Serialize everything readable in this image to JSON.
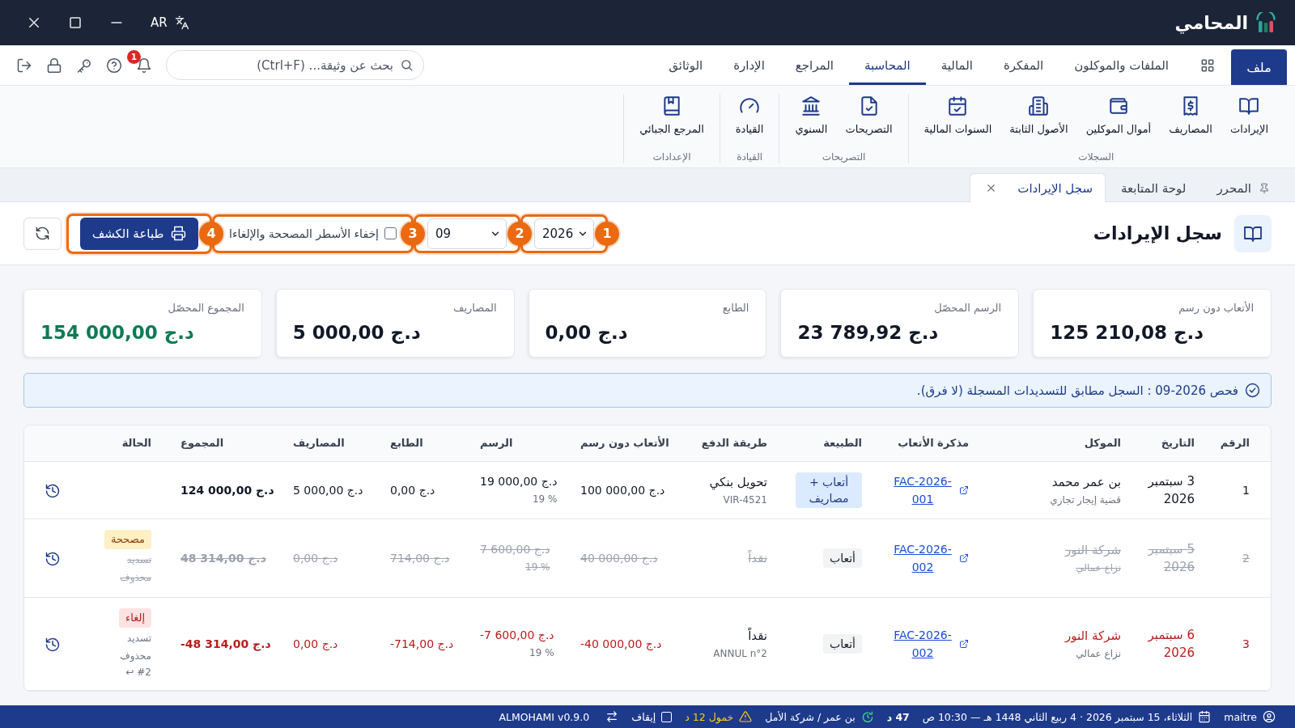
{
  "window": {
    "app_name": "المحامي",
    "language": "AR"
  },
  "menu": {
    "file_button": "ملف",
    "tabs": [
      {
        "label": "الملفات والموكلون",
        "selected": false
      },
      {
        "label": "المفكرة",
        "selected": false
      },
      {
        "label": "المالية",
        "selected": false
      },
      {
        "label": "المحاسبة",
        "selected": true
      },
      {
        "label": "المراجع",
        "selected": false
      },
      {
        "label": "الإدارة",
        "selected": false
      },
      {
        "label": "الوثائق",
        "selected": false
      }
    ],
    "search": {
      "placeholder": "بحث عن وثيقة... (Ctrl+F)"
    },
    "notification_count": "1"
  },
  "ribbon": {
    "groups": [
      {
        "label": "السجلات",
        "items": [
          "الإيرادات",
          "المصاريف",
          "أموال الموكلين",
          "الأصول الثابتة",
          "السنوات المالية"
        ]
      },
      {
        "label": "التصريحات",
        "items": [
          "التصريحات",
          "السنوي"
        ]
      },
      {
        "label": "القيادة",
        "items": [
          "القيادة"
        ]
      },
      {
        "label": "الإعدادات",
        "items": [
          "المرجع الجبائي"
        ]
      }
    ]
  },
  "document_tabs": [
    {
      "label": "المحرر",
      "pinned": true,
      "closable": false,
      "selected": false
    },
    {
      "label": "لوحة المتابعة",
      "pinned": false,
      "closable": false,
      "selected": false
    },
    {
      "label": "سجل الإيرادات",
      "pinned": false,
      "closable": true,
      "selected": true
    }
  ],
  "page": {
    "title": "سجل الإيرادات",
    "year": {
      "value": "2026",
      "marker": "1"
    },
    "month": {
      "value": "09",
      "marker": "2"
    },
    "hide_corrected": {
      "label": "إخفاء الأسطر المصححة والإلغاءا",
      "checked": false,
      "marker": "3"
    },
    "print_button": {
      "label": "طباعة الكشف",
      "marker": "4"
    }
  },
  "summary_cards": [
    {
      "label": "الأتعاب دون رسم",
      "value": "125 210,08 د.ج",
      "highlight": false
    },
    {
      "label": "الرسم المحصّل",
      "value": "23 789,92 د.ج",
      "highlight": false
    },
    {
      "label": "الطابع",
      "value": "0,00 د.ج",
      "highlight": false
    },
    {
      "label": "المصاريف",
      "value": "5 000,00 د.ج",
      "highlight": false
    },
    {
      "label": "المجموع المحصّل",
      "value": "154 000,00 د.ج",
      "highlight": true
    }
  ],
  "check_notice": "فحص 2026-09 : السجل مطابق للتسديدات المسجلة (لا فرق).",
  "table": {
    "columns": [
      "الرقم",
      "التاريخ",
      "الموكل",
      "مذكرة الأتعاب",
      "الطبيعة",
      "طريقة الدفع",
      "الأتعاب دون رسم",
      "الرسم",
      "الطابع",
      "المصاريف",
      "المجموع",
      "الحالة"
    ],
    "rows": [
      {
        "number": "1",
        "date": "3 سبتمبر 2026",
        "client": "بن عمر محمد",
        "case": "قضية إيجار تجاري",
        "invoice": "FAC-2026-001",
        "nature": {
          "label": "أتعاب + مصاريف",
          "kind": "fees_expenses"
        },
        "payment": "تحويل بنكي",
        "payment_ref": "VIR-4521",
        "fees": "100 000,00 د.ج",
        "tax": "19 000,00 د.ج",
        "tax_rate": "19 %",
        "stamp": "0,00 د.ج",
        "expenses": "5 000,00 د.ج",
        "total": "124 000,00 د.ج",
        "kind": "normal"
      },
      {
        "number": "2",
        "date": "5 سبتمبر 2026",
        "client": "شركة النور",
        "case": "نزاع عمالي",
        "invoice": "FAC-2026-002",
        "nature": {
          "label": "أتعاب",
          "kind": "fees"
        },
        "payment": "نقداً",
        "fees": "40 000,00 د.ج",
        "tax": "7 600,00 د.ج",
        "tax_rate": "19 %",
        "stamp": "714,00 د.ج",
        "expenses": "0,00 د.ج",
        "total": "48 314,00 د.ج",
        "kind": "corrected",
        "status": "مصححة",
        "status_note": "تسديد محذوف"
      },
      {
        "number": "3",
        "date": "6 سبتمبر 2026",
        "client": "شركة النور",
        "case": "نزاع عمالي",
        "invoice": "FAC-2026-002",
        "nature": {
          "label": "أتعاب",
          "kind": "fees"
        },
        "payment": "نقداً",
        "payment_ref": "ANNUL n°2",
        "fees": "-40 000,00 د.ج",
        "tax": "-7 600,00 د.ج",
        "tax_rate": "19 %",
        "stamp": "-714,00 د.ج",
        "expenses": "0,00 د.ج",
        "total": "-48 314,00 د.ج",
        "kind": "cancelled",
        "status": "إلغاء",
        "status_note": "تسديد محذوف",
        "reversal_ref": "#2 ↩"
      }
    ]
  },
  "status_bar": {
    "user": "maitre",
    "datetime": "الثلاثاء، 15 سبتمبر 2026 · 4 ربيع الثاني 1448 هـ — 10:30 ص",
    "timer": "47 د",
    "client": "بن عمر / شركة الأمل",
    "idle": "خمول 12 د",
    "pause": {
      "label": "إيقاف",
      "checked": false
    },
    "version": "ALMOHAMI v0.9.0"
  }
}
